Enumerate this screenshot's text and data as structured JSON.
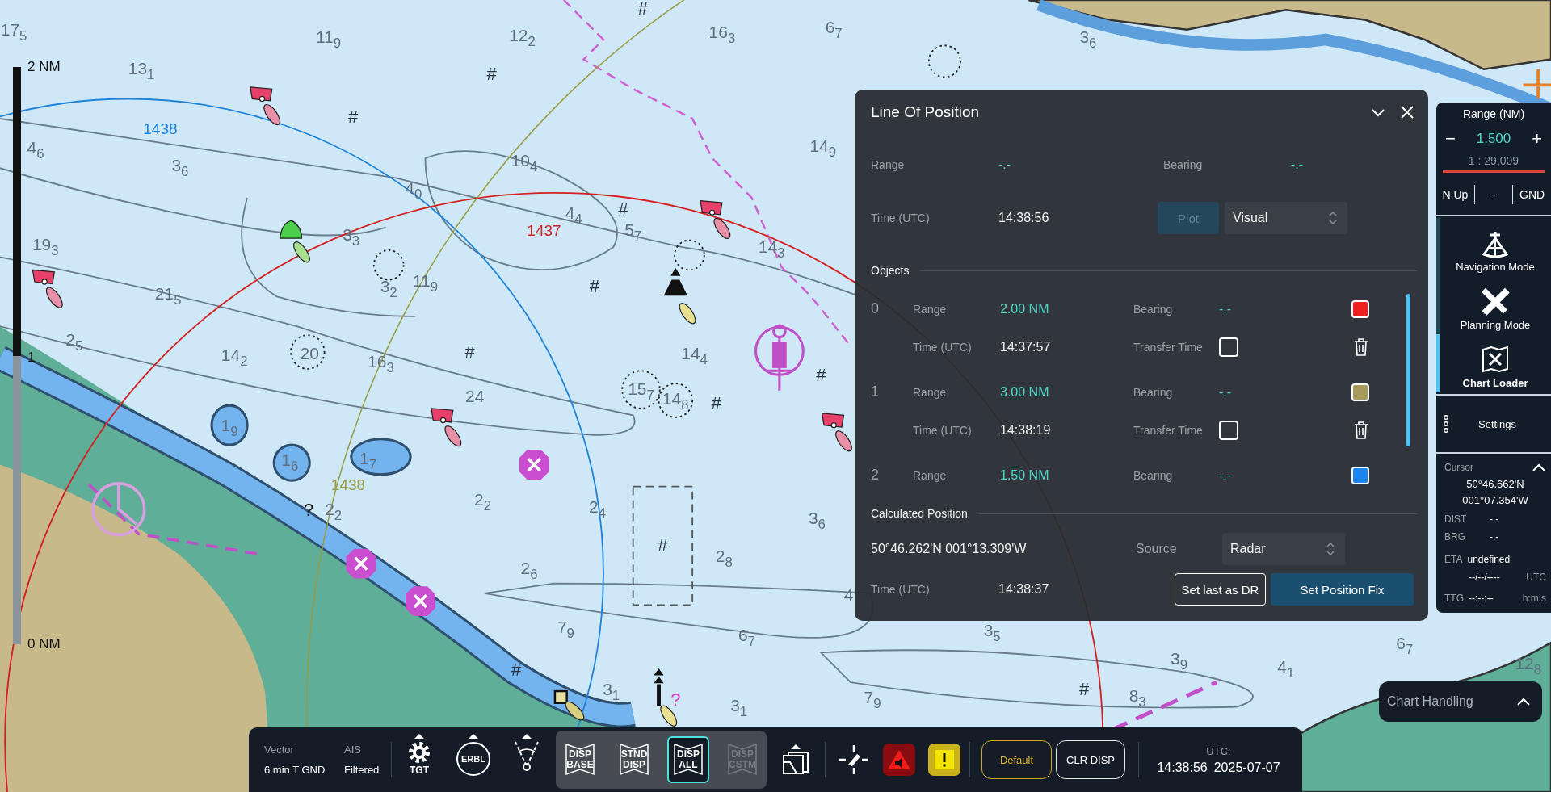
{
  "scale_bar": {
    "top_label": "2 NM",
    "middle_label": "1",
    "bottom_label": "0 NM"
  },
  "chart": {
    "soundings": [
      "17$_{5}$",
      "11$_{9}$",
      "12$_{2}$",
      "16$_{3}$",
      "6$_{7}$",
      "3$_{6}$",
      "13$_{1}$",
      "4$_{6}$",
      "3$_{6}$",
      "10$_{4}$",
      "14$_{9}$",
      "4$_{0}$",
      "19$_{3}$",
      "3$_{3}$",
      "4$_{4}$",
      "5$_{7}$",
      "14$_{3}$",
      "21$_{5}$",
      "3$_{2}$",
      "11$_{9}$",
      "2$_{5}$",
      "14$_{2}$",
      "20",
      "16$_{3}$",
      "14$_{4}$",
      "24",
      "15$_{7}$",
      "14$_{8}$",
      "1$_{9}$",
      "1$_{6}$",
      "1$_{7}$",
      "2$_{2}$",
      "2$_{2}$",
      "2$_{4}$",
      "3$_{6}$",
      "2$_{6}$",
      "2$_{8}$",
      "4",
      "7$_{9}$",
      "6$_{7}$",
      "3$_{5}$",
      "6$_{7}$",
      "3$_{9}$",
      "4$_{1}$",
      "12$_{8}$",
      "3$_{1}$",
      "3$_{1}$",
      "7$_{9}$",
      "8$_{3}$"
    ],
    "obstruction_marks": [
      "#",
      "#",
      "#",
      "#",
      "#",
      "#",
      "#",
      "#",
      "#",
      "#",
      "#"
    ],
    "line_labels": [
      {
        "text": "1438",
        "color": "#1f84d8"
      },
      {
        "text": "1437",
        "color": "#d42020"
      },
      {
        "text": "1438",
        "color": "#9a9a40"
      }
    ],
    "query_marks": [
      {
        "text": "?",
        "color": "#111111"
      },
      {
        "text": "?",
        "color": "#d040c0"
      }
    ]
  },
  "line_of_position": {
    "title": "Line Of Position",
    "range_label": "Range",
    "range": "-.-",
    "bearing_label": "Bearing",
    "bearing": "-.-",
    "time_label": "Time (UTC)",
    "time": "14:38:56",
    "plot_button": {
      "label": "Plot",
      "disabled": true
    },
    "method": "Visual",
    "objects_heading": "Objects",
    "objects": [
      {
        "index": "0",
        "range_label": "Range",
        "range": "2.00 NM",
        "bearing_label": "Bearing",
        "bearing": "-.-",
        "time_label": "Time (UTC)",
        "time": "14:37:57",
        "transfer_label": "Transfer Time",
        "transfer_time": false,
        "color": "#f02020"
      },
      {
        "index": "1",
        "range_label": "Range",
        "range": "3.00 NM",
        "bearing_label": "Bearing",
        "bearing": "-.-",
        "time_label": "Time (UTC)",
        "time": "14:38:19",
        "transfer_label": "Transfer Time",
        "transfer_time": false,
        "color": "#a89a5c"
      },
      {
        "index": "2",
        "range_label": "Range",
        "range": "1.50 NM",
        "bearing_label": "Bearing",
        "bearing": "-.-",
        "color": "#1a84f0"
      }
    ],
    "calculated_heading": "Calculated Position",
    "position": "50°46.262'N 001°13.309'W",
    "source_label": "Source",
    "source": "Radar",
    "calc_time_label": "Time (UTC)",
    "calc_time": "14:38:37",
    "buttons": [
      {
        "label": "Set last as DR",
        "kind": "outline"
      },
      {
        "label": "Set Position Fix",
        "kind": "primary"
      }
    ]
  },
  "range_panel": {
    "title": "Range (NM)",
    "decrease": "−",
    "value": "1.500",
    "increase": "+",
    "scale": "1 : 29,009",
    "orientation": "N Up",
    "mode": "-",
    "motion": "GND"
  },
  "modes": [
    {
      "kind": "navigation",
      "label": "Navigation Mode",
      "selected": false
    },
    {
      "kind": "planning",
      "label": "Planning Mode",
      "selected": false
    },
    {
      "kind": "charts",
      "label": "Chart Loader",
      "selected": true
    }
  ],
  "settings": {
    "label": "Settings"
  },
  "cursor": {
    "title": "Cursor",
    "latitude": "50°46.662'N",
    "longitude": "001°07.354'W",
    "dist_label": "DIST",
    "dist": "-.-",
    "brg_label": "BRG",
    "brg": "-.-",
    "eta_label": "ETA",
    "eta": "undefined",
    "eta_date": "--/--/----",
    "eta_unit": "UTC",
    "ttg_label": "TTG",
    "ttg": "--:--:--",
    "ttg_unit": "h:m:s"
  },
  "toolbar": {
    "vector_label": "Vector",
    "vector": "6 min T GND",
    "ais_label": "AIS",
    "ais": "Filtered",
    "tools": [
      {
        "kind": "target",
        "label": "TGT"
      },
      {
        "kind": "erbl",
        "label": "ERBL"
      },
      {
        "kind": "angle"
      }
    ],
    "display_buttons": [
      {
        "label": "DISP BASE",
        "selected": false,
        "disabled": false
      },
      {
        "label": "STND DISP",
        "selected": false,
        "disabled": false
      },
      {
        "label": "DISP ALL",
        "selected": true,
        "disabled": false
      },
      {
        "label": "DISP CSTM",
        "selected": false,
        "disabled": true
      }
    ],
    "profile_button": "Default",
    "clear_button": "CLR DISP",
    "utc_label": "UTC:",
    "utc_time": "14:38:56",
    "utc_date": "2025-07-07"
  },
  "chart_handling": {
    "label": "Chart Handling",
    "expanded": false
  }
}
